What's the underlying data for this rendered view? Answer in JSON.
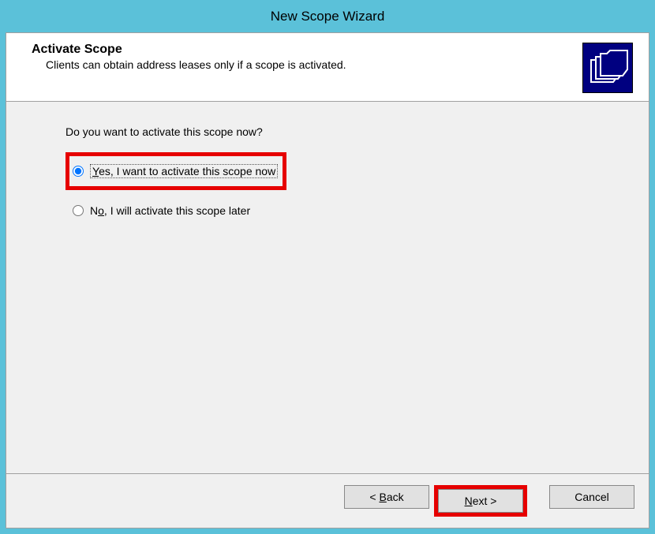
{
  "window": {
    "title": "New Scope Wizard"
  },
  "header": {
    "heading": "Activate Scope",
    "subtext": "Clients can obtain address leases only if a scope is activated.",
    "icon_name": "folder-icon"
  },
  "body": {
    "question": "Do you want to activate this scope now?",
    "options": {
      "yes": {
        "prefix": "Y",
        "rest": "es, I want to activate this scope now",
        "selected": true
      },
      "no": {
        "prefix": "N",
        "underline": "o",
        "rest": ", I will activate this scope later",
        "selected": false
      }
    }
  },
  "buttons": {
    "back": {
      "lt": "< ",
      "u": "B",
      "rest": "ack"
    },
    "next": {
      "u": "N",
      "rest": "ext >"
    },
    "cancel": {
      "label": "Cancel"
    }
  },
  "colors": {
    "highlight": "#e60000",
    "chrome": "#5bc1d9"
  }
}
